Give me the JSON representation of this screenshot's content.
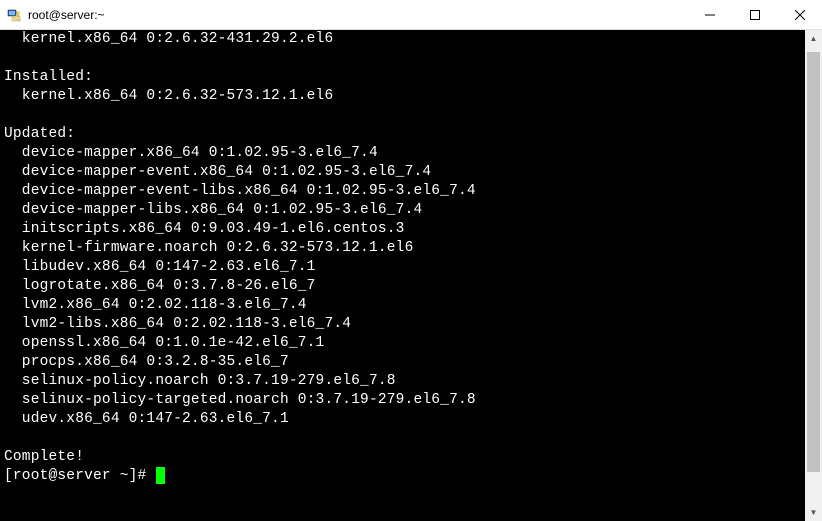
{
  "window": {
    "title": "root@server:~"
  },
  "terminal": {
    "lines": [
      "  kernel.x86_64 0:2.6.32-431.29.2.el6",
      "",
      "Installed:",
      "  kernel.x86_64 0:2.6.32-573.12.1.el6",
      "",
      "Updated:",
      "  device-mapper.x86_64 0:1.02.95-3.el6_7.4",
      "  device-mapper-event.x86_64 0:1.02.95-3.el6_7.4",
      "  device-mapper-event-libs.x86_64 0:1.02.95-3.el6_7.4",
      "  device-mapper-libs.x86_64 0:1.02.95-3.el6_7.4",
      "  initscripts.x86_64 0:9.03.49-1.el6.centos.3",
      "  kernel-firmware.noarch 0:2.6.32-573.12.1.el6",
      "  libudev.x86_64 0:147-2.63.el6_7.1",
      "  logrotate.x86_64 0:3.7.8-26.el6_7",
      "  lvm2.x86_64 0:2.02.118-3.el6_7.4",
      "  lvm2-libs.x86_64 0:2.02.118-3.el6_7.4",
      "  openssl.x86_64 0:1.0.1e-42.el6_7.1",
      "  procps.x86_64 0:3.2.8-35.el6_7",
      "  selinux-policy.noarch 0:3.7.19-279.el6_7.8",
      "  selinux-policy-targeted.noarch 0:3.7.19-279.el6_7.8",
      "  udev.x86_64 0:147-2.63.el6_7.1",
      "",
      "Complete!"
    ],
    "prompt": "[root@server ~]# "
  }
}
